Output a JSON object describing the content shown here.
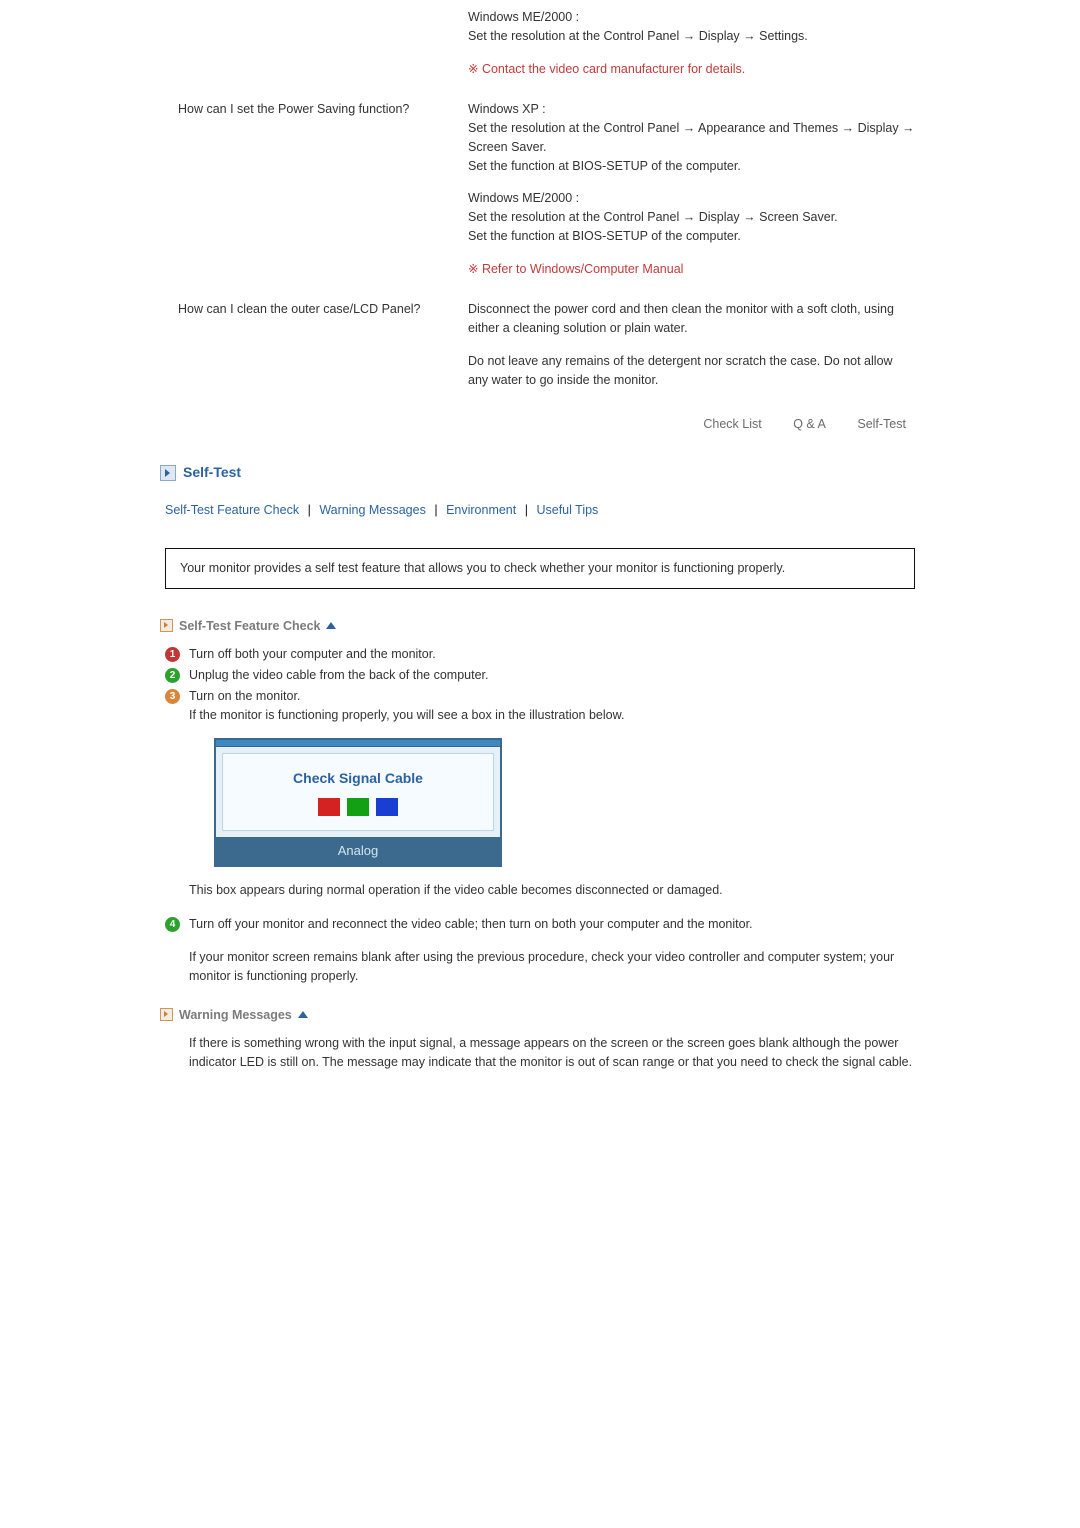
{
  "qa_prev": {
    "answer_me2000": "Windows ME/2000 :\nSet the resolution at the Control Panel → Display → Settings.",
    "note": "Contact the video card manufacturer for details."
  },
  "qa_power": {
    "question": "How can I set the Power Saving function?",
    "ans_xp": "Windows XP :\nSet the resolution at the Control Panel → Appearance and Themes → Display → Screen Saver.\nSet the function at BIOS-SETUP of the computer.",
    "ans_me": "Windows ME/2000 :\nSet the resolution at the Control Panel → Display → Screen Saver.\nSet the function at BIOS-SETUP of the computer.",
    "note": "Refer to Windows/Computer Manual"
  },
  "qa_clean": {
    "question": "How can I clean the outer case/LCD Panel?",
    "ans1": "Disconnect the power cord and then clean the monitor with a soft cloth, using either a cleaning solution or plain water.",
    "ans2": "Do not leave any remains of the detergent nor scratch the case. Do not allow any water to go inside the monitor."
  },
  "top_links": {
    "a": "Check List",
    "b": "Q & A",
    "c": "Self-Test"
  },
  "section_title": "Self-Test",
  "jump": {
    "a": "Self-Test Feature Check",
    "b": "Warning Messages",
    "c": "Environment",
    "d": "Useful Tips"
  },
  "intro": "Your monitor provides a self test feature that allows you to check whether your monitor is functioning properly.",
  "sub1": "Self-Test Feature Check",
  "steps": {
    "s1": "Turn off both your computer and the monitor.",
    "s2": "Unplug the video cable from the back of the computer.",
    "s3a": "Turn on the monitor.",
    "s3b": "If the monitor is functioning properly, you will see a box in the illustration below.",
    "s3c": "This box appears during normal operation if the video cable becomes disconnected or damaged.",
    "s4a": "Turn off your monitor and reconnect the video cable; then turn on both your computer and the monitor.",
    "s4b": "If your monitor screen remains blank after using the previous procedure, check your video controller and computer system; your monitor is functioning properly."
  },
  "diagram": {
    "msg": "Check Signal Cable",
    "mode": "Analog"
  },
  "sub2": "Warning Messages",
  "warn_text": "If there is something wrong with the input signal, a message appears on the screen or the screen goes blank although the power indicator LED is still on. The message may indicate that the monitor is out of scan range or that you need to check the signal cable."
}
